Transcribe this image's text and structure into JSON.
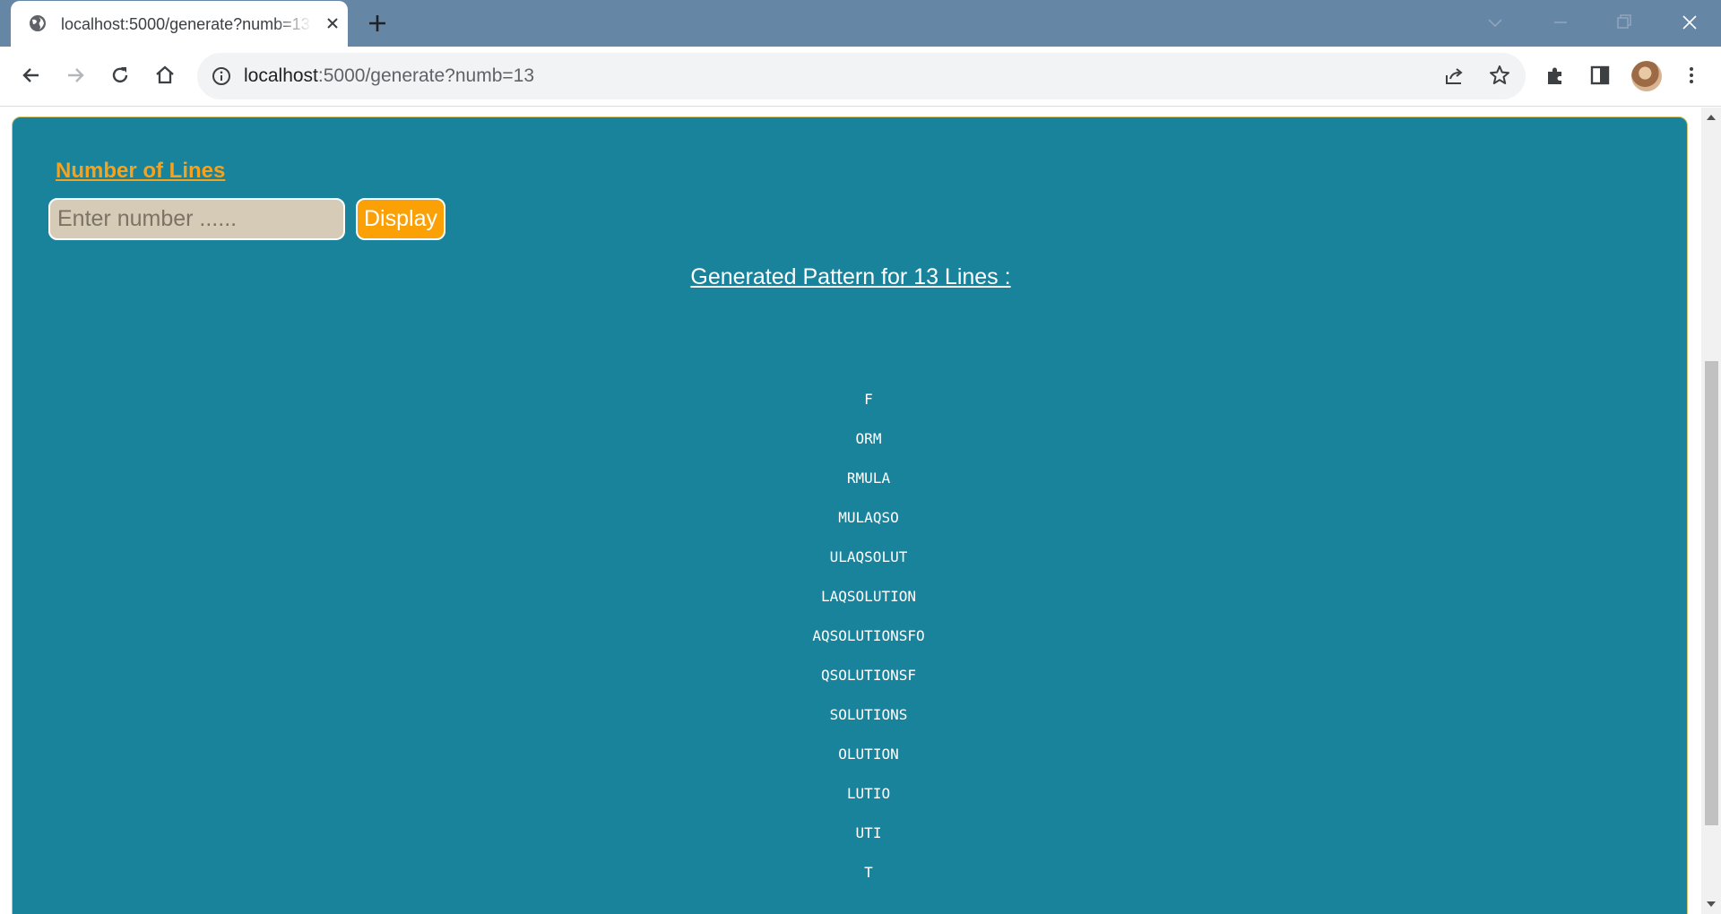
{
  "browser": {
    "tab_title": "localhost:5000/generate?numb=13",
    "url_host": "localhost",
    "url_rest": ":5000/generate?numb=13"
  },
  "icons": {
    "favicon": "globe-icon",
    "tab_close": "close-icon",
    "new_tab": "plus-icon",
    "back": "arrow-left-icon",
    "forward": "arrow-right-icon",
    "reload": "reload-icon",
    "home": "home-icon",
    "site_info": "info-icon",
    "share": "share-icon",
    "bookmark": "star-icon",
    "extensions": "puzzle-icon",
    "side_panel": "side-panel-icon",
    "menu": "kebab-menu-icon"
  },
  "page": {
    "number_label": "Number of Lines",
    "input_placeholder": "Enter number ......",
    "display_button": "Display",
    "result_title": "Generated Pattern for 13 Lines :",
    "pattern_lines": [
      "F",
      "ORM",
      "RMULA",
      "MULAQSO",
      "ULAQSOLUT",
      "LAQSOLUTION",
      "AQSOLUTIONSFO",
      "QSOLUTIONSF",
      "SOLUTIONS",
      "OLUTION",
      "LUTIO",
      "UTI",
      "T"
    ]
  },
  "colors": {
    "tabstrip": "#6686a6",
    "page_background": "#1a839c",
    "label_accent": "#f7a21a",
    "button": "#fca105",
    "input_background": "#d5cbb7"
  }
}
